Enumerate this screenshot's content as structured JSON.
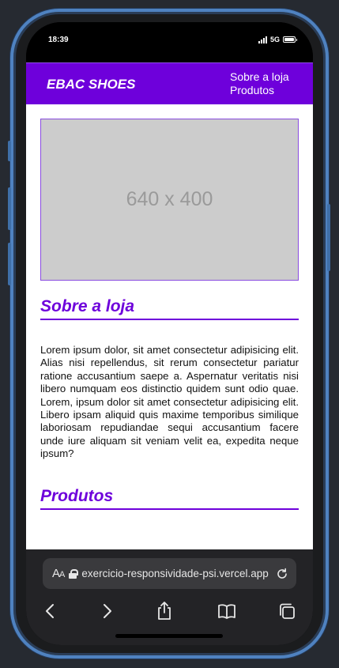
{
  "status_bar": {
    "time": "18:39",
    "network": "5G",
    "battery_level": 1.0
  },
  "site": {
    "brand": "EBAC SHOES",
    "nav": [
      "Sobre a loja",
      "Produtos"
    ],
    "hero_placeholder": "640 x 400",
    "sections": [
      {
        "title": "Sobre a loja",
        "body": "Lorem ipsum dolor, sit amet consectetur adipisicing elit. Alias nisi repellendus, sit rerum consectetur pariatur ratione accusantium saepe a. Aspernatur veritatis nisi libero numquam eos distinctio quidem sunt odio quae. Lorem, ipsum dolor sit amet consectetur adipisicing elit. Libero ipsam aliquid quis maxime temporibus similique laboriosam repudiandae sequi accusantium facere unde iure aliquam sit veniam velit ea, expedita neque ipsum?"
      },
      {
        "title": "Produtos"
      }
    ],
    "colors": {
      "primary": "#6e00db",
      "placeholder_bg": "#cccccc"
    }
  },
  "browser": {
    "text_size_label": "AA",
    "url": "exercicio-responsividade-psi.vercel.app",
    "toolbar_icons": [
      "back-icon",
      "forward-icon",
      "share-icon",
      "bookmarks-icon",
      "tabs-icon"
    ]
  }
}
